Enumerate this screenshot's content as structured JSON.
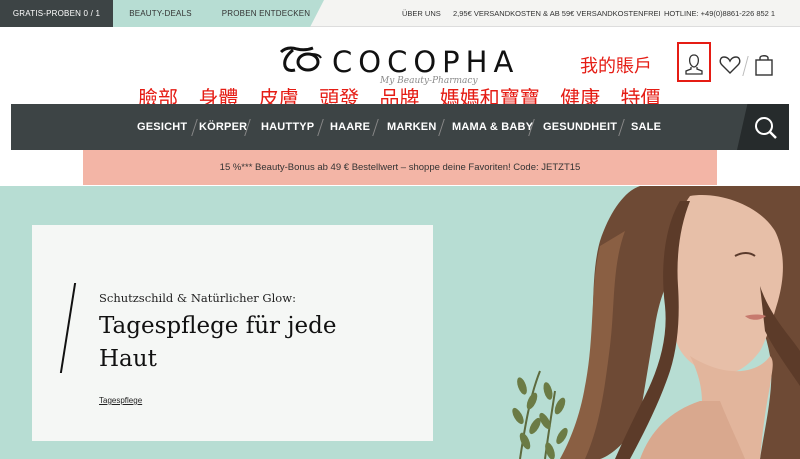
{
  "topbar": {
    "tabs": [
      "GRATIS-PROBEN 0 / 1",
      "BEAUTY-DEALS",
      "PROBEN ENTDECKEN"
    ],
    "info": [
      "ÜBER UNS",
      "2,95€ VERSANDKOSTEN & AB 59€ VERSANDKOSTENFREI",
      "HOTLINE: +49(0)8861-226 852 1"
    ]
  },
  "header": {
    "logo_mark": "ℭ",
    "logo_text": "COCOPHA",
    "logo_sub": "My Beauty-Pharmacy",
    "account_label": "我的賬戶",
    "chinese_categories": [
      "臉部",
      "身體",
      "皮膚",
      "頭發",
      "品牌",
      "媽媽和寶寶",
      "健康",
      "特價"
    ],
    "icons": [
      "user-icon",
      "heart-icon",
      "shopping-bag-icon"
    ]
  },
  "nav": {
    "items": [
      "GESICHT",
      "KÖRPER",
      "HAUTTYP",
      "HAARE",
      "MARKEN",
      "MAMA & BABY",
      "GESUNDHEIT",
      "SALE"
    ],
    "search_icon": "search-icon"
  },
  "promo": {
    "text": "15 %*** Beauty-Bonus ab 49 € Bestellwert – shoppe deine Favoriten! Code:   JETZT15"
  },
  "hero": {
    "subtitle": "Schutzschild & Natürlicher Glow:",
    "title": "Tagespflege für jede Haut",
    "link": "Tagespflege"
  },
  "colors": {
    "dark": "#3d4445",
    "mint": "#b7ddd3",
    "salmon": "#f3b5a6",
    "red": "#e51c14"
  }
}
